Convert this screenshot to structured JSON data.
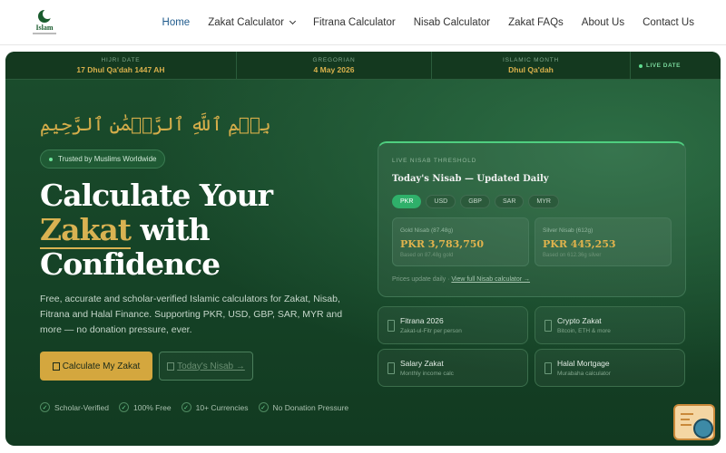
{
  "brand": {
    "logo_text": "Islam"
  },
  "nav": {
    "home": "Home",
    "zakat_calculator": "Zakat Calculator",
    "fitrana_calculator": "Fitrana Calculator",
    "nisab_calculator": "Nisab Calculator",
    "zakat_faqs": "Zakat FAQs",
    "about_us": "About Us",
    "contact_us": "Contact Us"
  },
  "datebar": {
    "hijri_label": "HIJRI DATE",
    "hijri_value": "17 Dhul Qa'dah 1447 AH",
    "gregorian_label": "GREGORIAN",
    "gregorian_value": "4 May 2026",
    "month_label": "ISLAMIC MONTH",
    "month_value": "Dhul Qa'dah",
    "live_label": "LIVE DATE"
  },
  "hero": {
    "arabic": "بِسۡمِ ٱللَّهِ ٱلرَّحۡمَٰنِ ٱلرَّحِيمِ",
    "trust_badge": "Trusted by Muslims Worldwide",
    "headline_line1": "Calculate Your",
    "headline_gold": "Zakat",
    "headline_line2_rest": " with",
    "headline_line3": "Confidence",
    "description": "Free, accurate and scholar-verified Islamic calculators for Zakat, Nisab, Fitrana and Halal Finance. Supporting PKR, USD, GBP, SAR, MYR and more — no donation pressure, ever.",
    "primary_button": "Calculate My Zakat",
    "secondary_button": "Today's Nisab →",
    "badges": [
      "Scholar-Verified",
      "100% Free",
      "10+ Currencies",
      "No Donation Pressure"
    ]
  },
  "nisab_card": {
    "label": "LIVE NISAB THRESHOLD",
    "title": "Today's Nisab — Updated Daily",
    "currencies": [
      "PKR",
      "USD",
      "GBP",
      "SAR",
      "MYR"
    ],
    "active_currency": "PKR",
    "gold_label": "Gold Nisab (87.48g)",
    "gold_value": "PKR 3,783,750",
    "gold_sub": "Based on 87.48g gold",
    "silver_label": "Silver Nisab (612g)",
    "silver_value": "PKR 445,253",
    "silver_sub": "Based on 612.36g silver",
    "footer_text": "Prices update daily · ",
    "footer_link": "View full Nisab calculator →"
  },
  "mini_cards": [
    {
      "title": "Fitrana 2026",
      "subtitle": "Zakat-ul-Fitr per person"
    },
    {
      "title": "Crypto Zakat",
      "subtitle": "Bitcoin, ETH & more"
    },
    {
      "title": "Salary Zakat",
      "subtitle": "Monthly income calc"
    },
    {
      "title": "Halal Mortgage",
      "subtitle": "Murabaha calculator"
    }
  ],
  "colors": {
    "accent_gold": "#d4a73e",
    "hero_green": "#1b4d2d",
    "live_green": "#4fcf80",
    "nav_active": "#1e5a8c"
  }
}
